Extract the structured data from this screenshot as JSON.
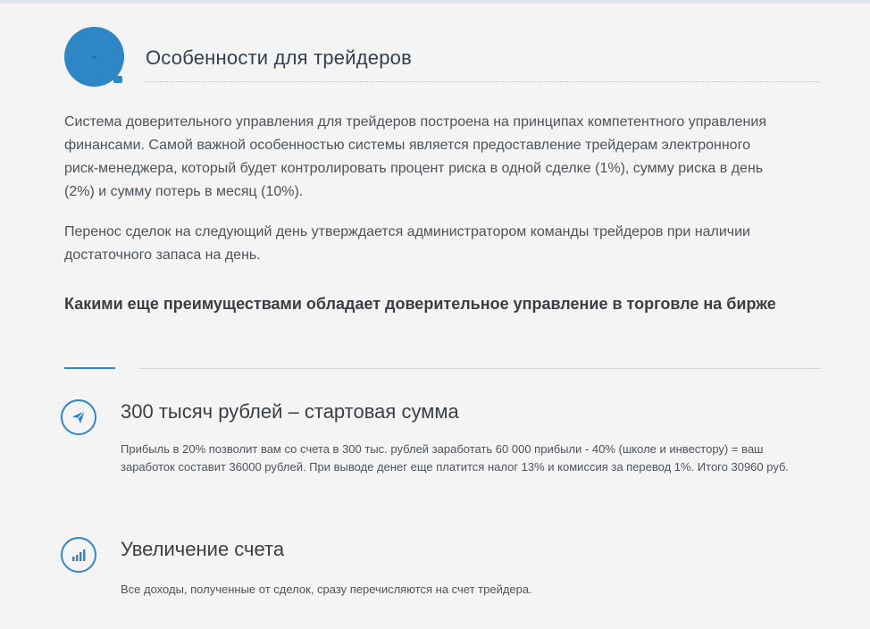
{
  "header": {
    "title": "Особенности для трейдеров",
    "badge_icon": "speech-bubble-icon"
  },
  "paragraphs": [
    "Система доверительного управления для трейдеров построена на принципах компетентного управления финансами. Самой важной особенностью системы является предоставление трейдерам электронного риск-менеджера, который будет контролировать процент риска в одной сделке (1%), сумму риска в день (2%) и сумму потерь в месяц (10%).",
    "Перенос сделок на следующий день утверждается администратором команды трейдеров при наличии достаточного запаса на день."
  ],
  "subheading": "Какими еще преимуществами обладает доверительное управление в торговле на бирже",
  "features": [
    {
      "icon": "paper-plane-icon",
      "title": "300 тысяч рублей – стартовая сумма",
      "text": "Прибыль в 20% позволит вам со счета в 300 тыс. рублей заработать 60 000 прибыли - 40% (школе и инвестору) = ваш заработок составит 36000 рублей. При выводе денег еще платится налог 13% и комиссия за перевод 1%. Итого 30960 руб."
    },
    {
      "icon": "bar-chart-icon",
      "title": "Увеличение счета",
      "text": "Все доходы, полученные от сделок, сразу перечисляются на счет трейдера."
    }
  ],
  "colors": {
    "accent": "#2f86c7",
    "background": "#f4f4f4",
    "text": "#4d535a"
  }
}
